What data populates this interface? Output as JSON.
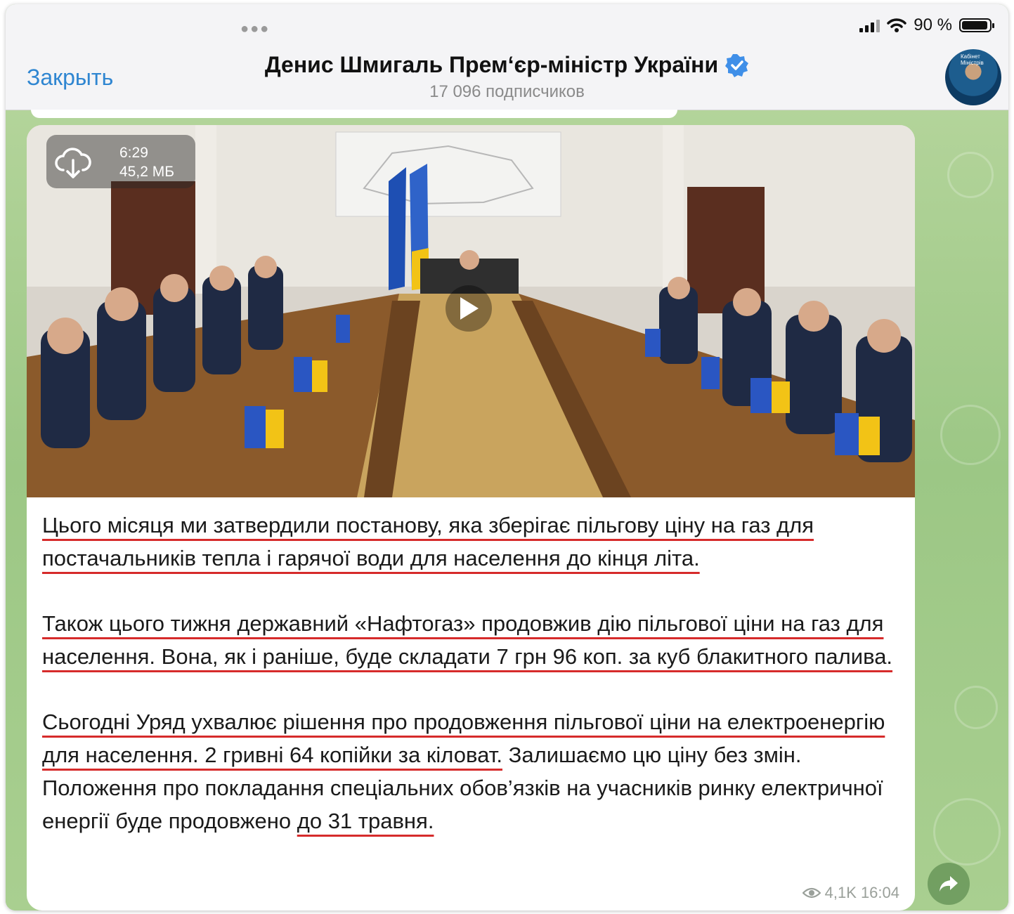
{
  "status_bar": {
    "battery": "90 %"
  },
  "header": {
    "close_label": "Закрыть",
    "channel_title": "Денис Шмигаль Прем‘єр-міністр України",
    "subscribers": "17 096 подписчиков",
    "verified_icon": "verified-badge-icon",
    "avatar_caption": "Кабінет Міністрів"
  },
  "video": {
    "duration": "6:29",
    "size": "45,2 МБ",
    "download_icon": "cloud-download-icon",
    "play_icon": "play-icon"
  },
  "post": {
    "p1": "Цього місяця ми затвердили постанову, яка зберігає пільгову ціну на газ для постачальників тепла і гарячої води для населення до кінця літа.",
    "p2": "Також цього тижня державний «Нафтогаз» продовжив дію пільгової ціни на газ для населення. Вона, як і раніше, буде складати 7 грн 96 коп. за куб блакитного палива.",
    "p3_underlined": "Сьогодні Уряд ухвалює рішення про продовження пільгової ціни на електроенергію для населення. 2 гривні 64 копійки за кіловат.",
    "p3_plain": "Залишаємо цю ціну без змін. Положення про покладання спеціальних обов’язків на учасників ринку електричної енергії буде продовжено",
    "p3_end": "до 31 травня.",
    "views": "4,1K",
    "time": "16:04"
  },
  "share_icon": "share-arrow-icon"
}
